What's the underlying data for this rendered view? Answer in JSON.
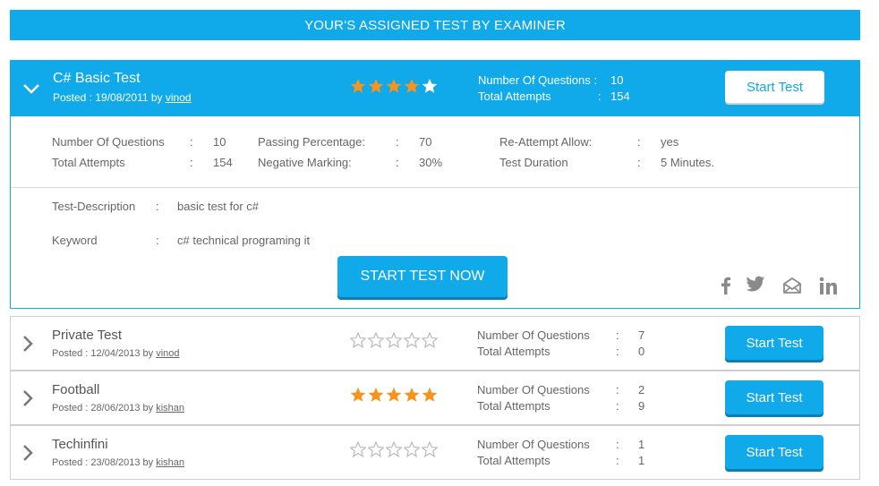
{
  "banner": {
    "title": "YOUR'S ASSIGNED TEST BY EXAMINER"
  },
  "colors": {
    "accent": "#10a9ea",
    "star_filled": "#f7941d",
    "star_empty": "#bbbbbb"
  },
  "expanded_test": {
    "title": "C# Basic Test",
    "posted_prefix": "Posted : 19/08/2011 by",
    "author": "vinod",
    "rating": 4,
    "stats": [
      {
        "label": "Number Of Questions :",
        "value": "10"
      },
      {
        "label": "Total Attempts",
        "colon": ":",
        "value": "154"
      }
    ],
    "start_button": "Start Test",
    "details": {
      "num_questions_label": "Number Of Questions",
      "num_questions_value": "10",
      "total_attempts_label": "Total Attempts",
      "total_attempts_value": "154",
      "passing_label": "Passing Percentage:",
      "passing_value": "70",
      "negative_label": "Negative Marking:",
      "negative_value": "30%",
      "reattempt_label": "Re-Attempt Allow:",
      "reattempt_value": "yes",
      "duration_label": "Test Duration",
      "duration_value": "5 Minutes.",
      "colon": ":"
    },
    "description_label": "Test-Description",
    "description_value": "basic test for c#",
    "keyword_label": "Keyword",
    "keyword_value": "c# technical programing it",
    "start_now_button": "START TEST NOW",
    "social_icons": [
      "facebook-icon",
      "twitter-icon",
      "email-icon",
      "linkedin-icon"
    ]
  },
  "tests": [
    {
      "title": "Private Test",
      "posted_prefix": "Posted : 12/04/2013 by",
      "author": "vinod",
      "rating": 0,
      "num_questions_label": "Number Of Questions",
      "num_questions_value": "7",
      "total_attempts_label": "Total Attempts",
      "total_attempts_value": "0",
      "button": "Start Test"
    },
    {
      "title": "Football",
      "posted_prefix": "Posted : 28/06/2013 by",
      "author": "kishan",
      "rating": 5,
      "num_questions_label": "Number Of Questions",
      "num_questions_value": "2",
      "total_attempts_label": "Total Attempts",
      "total_attempts_value": "9",
      "button": "Start Test"
    },
    {
      "title": "Techinfini",
      "posted_prefix": "Posted : 23/08/2013 by",
      "author": "kishan",
      "rating": 0,
      "num_questions_label": "Number Of Questions",
      "num_questions_value": "1",
      "total_attempts_label": "Total Attempts",
      "total_attempts_value": "1",
      "button": "Start Test"
    }
  ],
  "colon": ":"
}
